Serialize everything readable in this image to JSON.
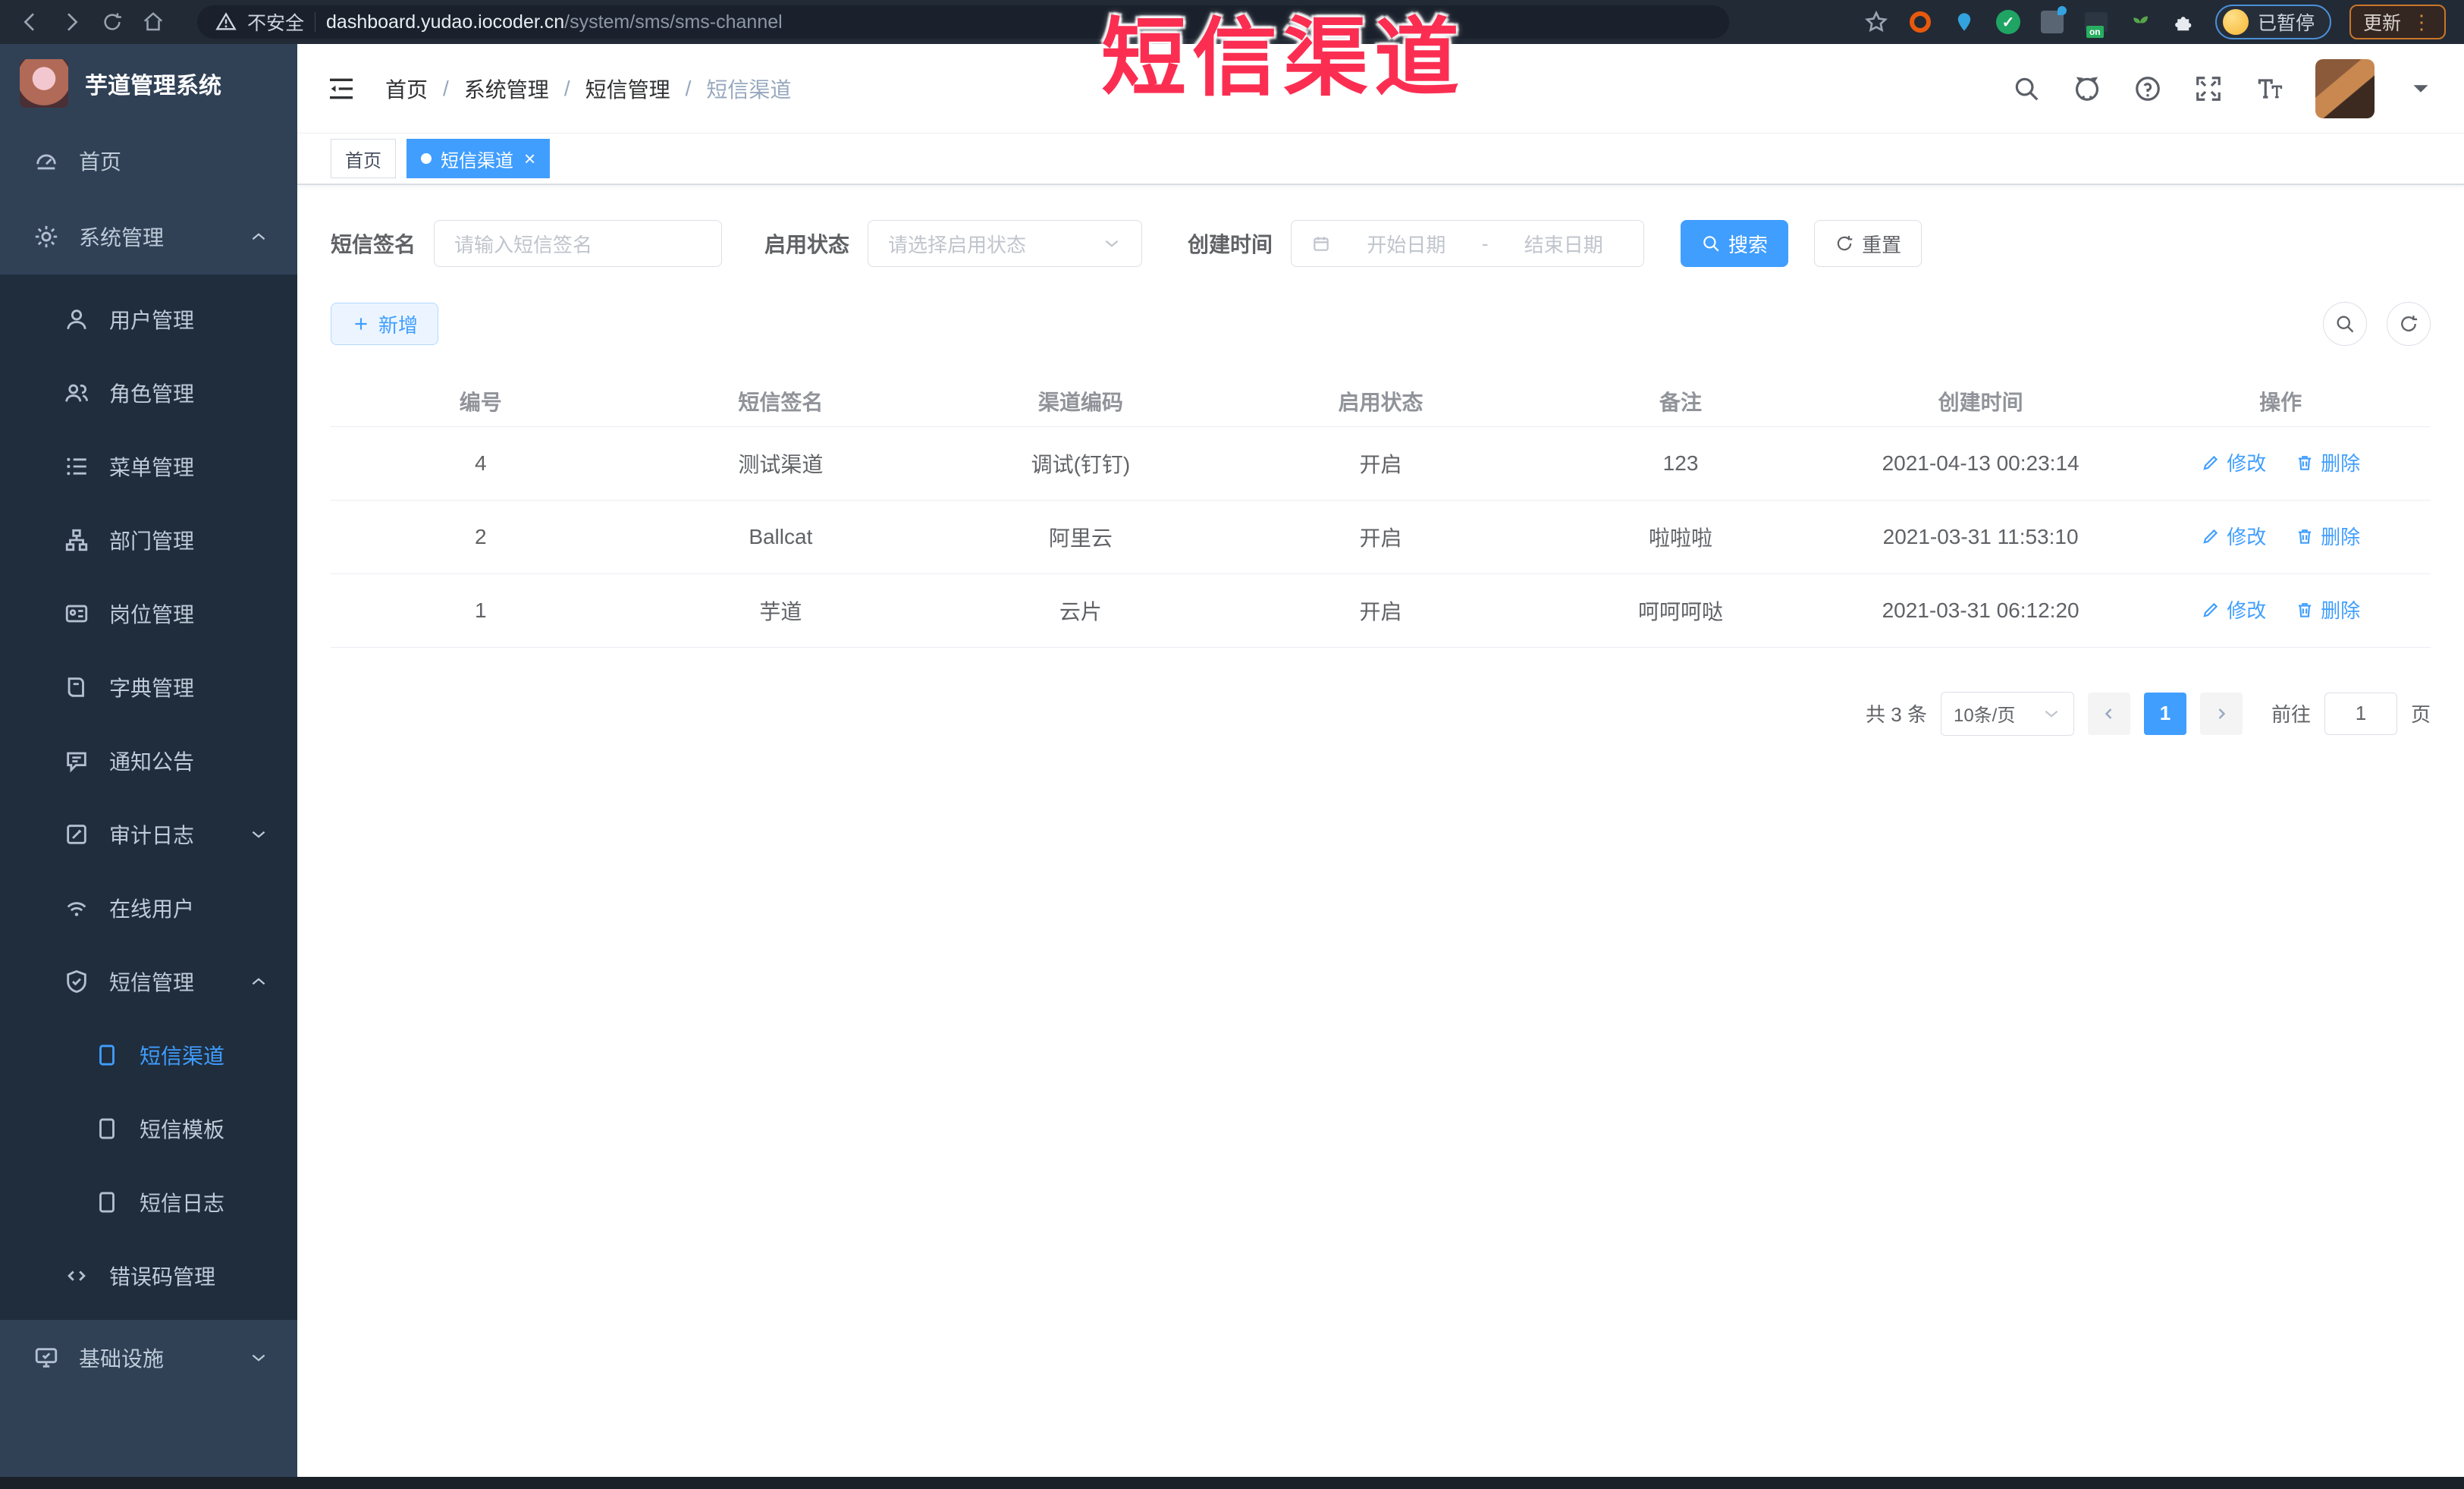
{
  "browser": {
    "security_label": "不安全",
    "url_host": "dashboard.yudao.iocoder.cn",
    "url_path": "/system/sms/sms-channel",
    "paused_label": "已暂停",
    "update_label": "更新",
    "update_dots": "⋮",
    "extension_icons": [
      "bookmark-star",
      "orange-ring-extension",
      "blue-pin-extension",
      "green-check-extension",
      "tampermonkey-extension",
      "vpn-on-extension",
      "plant-extension",
      "extensions-puzzle"
    ]
  },
  "annotation": {
    "text": "短信渠道",
    "color": "#fb2e52"
  },
  "sidebar": {
    "logo_title": "芋道管理系统",
    "items": [
      {
        "label": "首页",
        "icon": "dashboard"
      },
      {
        "label": "系统管理",
        "icon": "gear"
      },
      {
        "label": "用户管理",
        "icon": "user"
      },
      {
        "label": "角色管理",
        "icon": "users"
      },
      {
        "label": "菜单管理",
        "icon": "menu-list"
      },
      {
        "label": "部门管理",
        "icon": "org-tree"
      },
      {
        "label": "岗位管理",
        "icon": "postcard"
      },
      {
        "label": "字典管理",
        "icon": "dictionary"
      },
      {
        "label": "通知公告",
        "icon": "announcement"
      },
      {
        "label": "审计日志",
        "icon": "audit-log"
      },
      {
        "label": "在线用户",
        "icon": "online"
      },
      {
        "label": "短信管理",
        "icon": "shield-sms"
      },
      {
        "label": "短信渠道",
        "icon": "document"
      },
      {
        "label": "短信模板",
        "icon": "document"
      },
      {
        "label": "短信日志",
        "icon": "document"
      },
      {
        "label": "错误码管理",
        "icon": "code"
      },
      {
        "label": "基础设施",
        "icon": "monitor"
      }
    ]
  },
  "header": {
    "breadcrumb": [
      "首页",
      "系统管理",
      "短信管理",
      "短信渠道"
    ],
    "separator": "/"
  },
  "tabs": {
    "items": [
      {
        "label": "首页"
      },
      {
        "label": "短信渠道"
      }
    ],
    "close_glyph": "×"
  },
  "filters": {
    "sign_label": "短信签名",
    "sign_placeholder": "请输入短信签名",
    "status_label": "启用状态",
    "status_placeholder": "请选择启用状态",
    "time_label": "创建时间",
    "start_placeholder": "开始日期",
    "range_separator": "-",
    "end_placeholder": "结束日期",
    "search_label": "搜索",
    "reset_label": "重置"
  },
  "toolbar": {
    "add_label": "新增"
  },
  "table": {
    "columns": [
      "编号",
      "短信签名",
      "渠道编码",
      "启用状态",
      "备注",
      "创建时间",
      "操作"
    ],
    "rows": [
      {
        "id": "4",
        "sign": "测试渠道",
        "code": "调试(钉钉)",
        "status": "开启",
        "remark": "123",
        "created": "2021-04-13 00:23:14"
      },
      {
        "id": "2",
        "sign": "Ballcat",
        "code": "阿里云",
        "status": "开启",
        "remark": "啦啦啦",
        "created": "2021-03-31 11:53:10"
      },
      {
        "id": "1",
        "sign": "芋道",
        "code": "云片",
        "status": "开启",
        "remark": "呵呵呵哒",
        "created": "2021-03-31 06:12:20"
      }
    ],
    "edit_label": "修改",
    "delete_label": "删除"
  },
  "pagination": {
    "total": "共 3 条",
    "page_size": "10条/页",
    "current_page": "1",
    "goto_label": "前往",
    "goto_value": "1",
    "page_unit": "页"
  },
  "colors": {
    "accent": "#409eff",
    "sidebar_bg": "#304156",
    "submenu_bg": "#1f2d3d",
    "chrome_bg": "#222a35"
  }
}
